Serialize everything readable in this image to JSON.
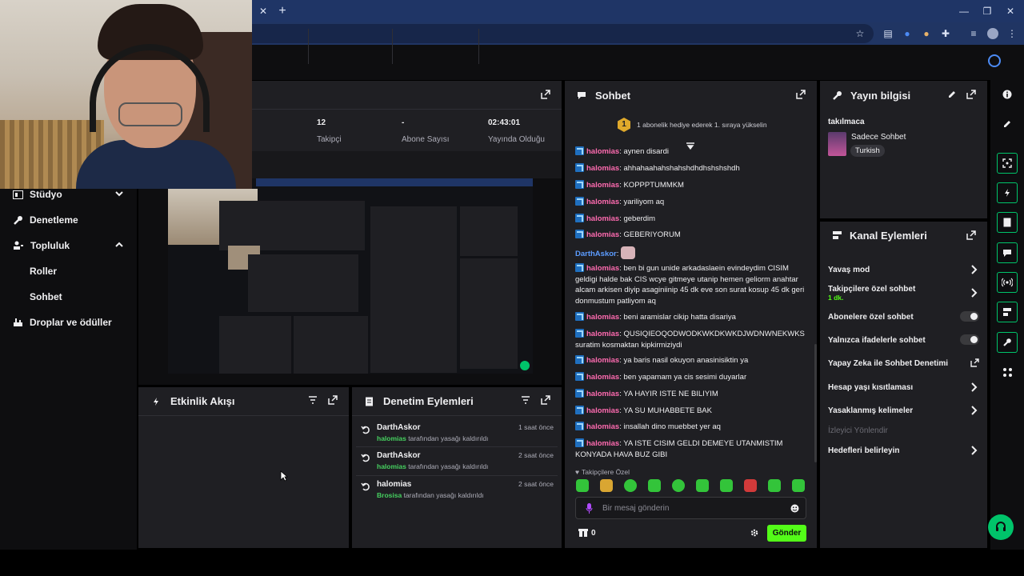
{
  "stats": {
    "followers_value": "12",
    "followers_label": "Takipçi",
    "subs_value": "-",
    "subs_label": "Abone Sayısı",
    "uptime_value": "02:43:01",
    "uptime_label": "Yayında Olduğu"
  },
  "sidebar": {
    "items": [
      {
        "label": "Stüdyo"
      },
      {
        "label": "Denetleme"
      },
      {
        "label": "Topluluk"
      },
      {
        "label": "Roller"
      },
      {
        "label": "Sohbet"
      },
      {
        "label": "Droplar ve ödüller"
      }
    ]
  },
  "activity": {
    "title": "Etkinlik Akışı"
  },
  "modlog": {
    "title": "Denetim Eylemleri",
    "entries": [
      {
        "target": "DarthAskor",
        "actor": "halomias",
        "text": "tarafından yasağı kaldırıldı",
        "time": "1 saat önce"
      },
      {
        "target": "DarthAskor",
        "actor": "halomias",
        "text": "tarafından yasağı kaldırıldı",
        "time": "2 saat önce"
      },
      {
        "target": "halomias",
        "actor": "Brosisa",
        "text": "tarafından yasağı kaldırıldı",
        "time": "2 saat önce"
      }
    ]
  },
  "chat": {
    "title": "Sohbet",
    "hype_rank": "1",
    "hype_text": "1 abonelik hediye ederek 1. sıraya yükselin",
    "messages": [
      {
        "user": "halomias",
        "text": "aynen disardi"
      },
      {
        "user": "halomias",
        "text": "ahhahaahahshahshdhdhshshshdh"
      },
      {
        "user": "halomias",
        "text": "KOPPPTUMMKM"
      },
      {
        "user": "halomias",
        "text": "yariliyom aq"
      },
      {
        "user": "halomias",
        "text": "geberdim"
      },
      {
        "user": "halomias",
        "text": "GEBERIYORUM"
      },
      {
        "user": "DarthAskor",
        "text": ""
      },
      {
        "user": "halomias",
        "text": "ben bi gun unide arkadaslaein evindeydim CISIM geldigi halde bak CIS wcye gitmeye utanip hemen geliorm anahtar alcam arkisen diyip asaginiinip 45 dk eve son surat kosup 45 dk geri donmustum patliyom aq"
      },
      {
        "user": "halomias",
        "text": "beni aramislar cikip hatta disariya"
      },
      {
        "user": "halomias",
        "text": "QUSIQIEOQODWODKWKDKWKDJWDNWNEKWKS suratim kosmaktan kipkirmiziydi"
      },
      {
        "user": "halomias",
        "text": "ya baris nasil okuyon anasinisiktin ya"
      },
      {
        "user": "halomias",
        "text": "ben yapamam ya cis sesimi duyarlar"
      },
      {
        "user": "halomias",
        "text": "YA HAYIR ISTE NE BILIYIM"
      },
      {
        "user": "halomias",
        "text": "YA SU MUHABBETE BAK"
      },
      {
        "user": "halomias",
        "text": "insallah dino muebbet yer aq"
      },
      {
        "user": "halomias",
        "text": "YA ISTE CISIM GELDI DEMEYE UTANMISTIM KONYADA HAVA BUZ GIBI"
      }
    ],
    "follower_only_label": "Takipçilere Özel",
    "input_placeholder": "Bir mesaj gönderin",
    "points": "0",
    "send_label": "Gönder"
  },
  "stream_info": {
    "title": "Yayın bilgisi",
    "stream_title": "takılmaca",
    "category": "Sadece Sohbet",
    "tag": "Turkish"
  },
  "channel_actions": {
    "title": "Kanal Eylemleri",
    "rows": [
      {
        "label": "Yavaş mod"
      },
      {
        "label": "Takipçilere özel sohbet",
        "sub": "1 dk."
      },
      {
        "label": "Abonelere özel sohbet"
      },
      {
        "label": "Yalnızca ifadelerle sohbet"
      },
      {
        "label": "Yapay Zeka ile Sohbet Denetimi"
      },
      {
        "label": "Hesap yaşı kısıtlaması"
      },
      {
        "label": "Yasaklanmış kelimeler"
      },
      {
        "label": "İzleyici Yönlendir"
      },
      {
        "label": "Hedefleri belirleyin"
      }
    ]
  },
  "colors": {
    "accent": "#53fc18",
    "panel": "#1f1f23",
    "background": "#0e0e10",
    "username": "#ff6bb0"
  }
}
